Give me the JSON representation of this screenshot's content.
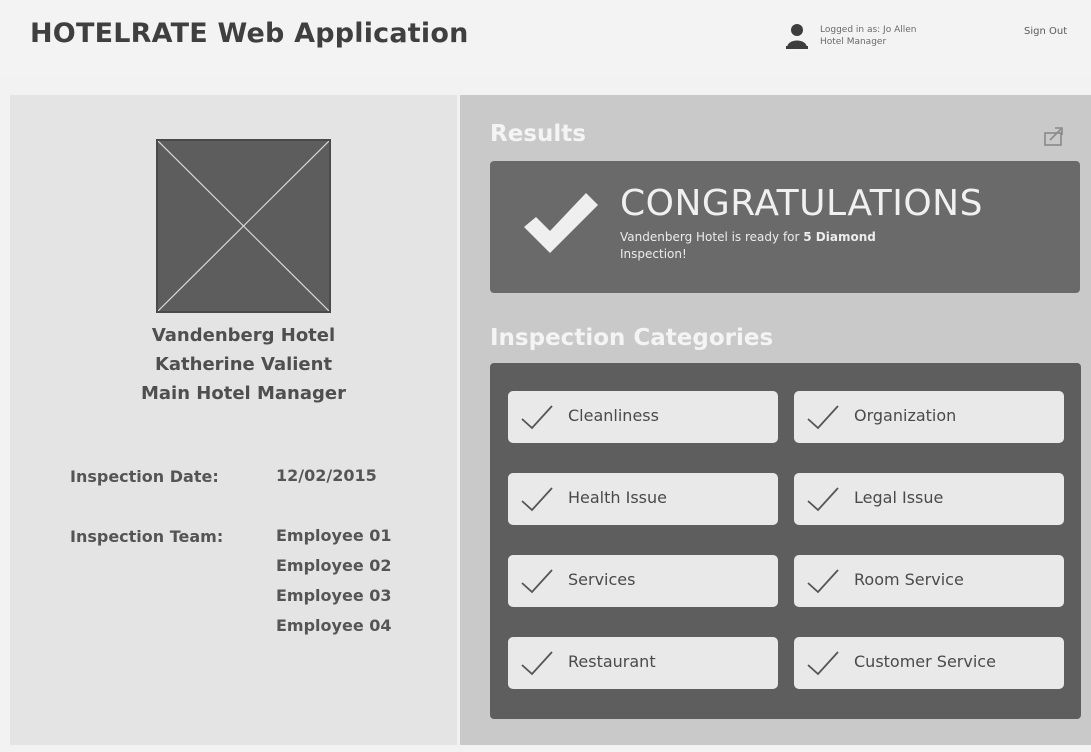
{
  "header": {
    "app_title": "HOTELRATE Web Application",
    "user_line1": "Logged in as: Jo Allen",
    "user_line2": "Hotel Manager",
    "sign_out": "Sign Out"
  },
  "profile": {
    "hotel_name": "Vandenberg Hotel",
    "manager_name": "Katherine Valient",
    "manager_title": "Main Hotel Manager"
  },
  "inspection": {
    "date_label": "Inspection Date:",
    "date_value": "12/02/2015",
    "team_label": "Inspection Team:",
    "team": [
      "Employee 01",
      "Employee 02",
      "Employee 03",
      "Employee 04"
    ]
  },
  "results": {
    "title": "Results",
    "headline": "CONGRATULATIONS",
    "message_prefix": "Vandenberg Hotel is ready for ",
    "message_bold": "5 Diamond",
    "message_suffix": "Inspection!"
  },
  "categories": {
    "title": "Inspection Categories",
    "items": [
      {
        "label": "Cleanliness"
      },
      {
        "label": "Organization"
      },
      {
        "label": "Health Issue"
      },
      {
        "label": "Legal Issue"
      },
      {
        "label": "Services"
      },
      {
        "label": "Room Service"
      },
      {
        "label": "Restaurant"
      },
      {
        "label": "Customer Service"
      }
    ]
  },
  "icons": {
    "user": "user-icon",
    "export": "export-icon",
    "check": "check-icon",
    "placeholder": "image-placeholder-icon"
  }
}
